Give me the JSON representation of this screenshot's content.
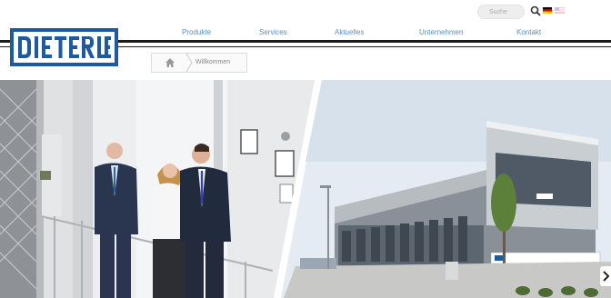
{
  "header": {
    "search": {
      "placeholder": "Suche"
    },
    "icons": {
      "search": "search-icon",
      "flag_de": "flag-de-icon",
      "flag_en": "flag-en-icon"
    },
    "logo_text": "DIETERLE"
  },
  "nav": {
    "items": [
      {
        "label": "Produkte"
      },
      {
        "label": "Services"
      },
      {
        "label": "Aktuelles"
      },
      {
        "label": "Unternehmen"
      },
      {
        "label": "Kontakt"
      }
    ]
  },
  "breadcrumb": {
    "home_icon": "home-icon",
    "label": "Willkommen"
  },
  "hero": {
    "next_icon": "chevron-right-icon"
  },
  "colors": {
    "nav_link": "#5a8fc2",
    "logo_blue": "#1e5aa0",
    "rule": "#1a1a1a"
  }
}
